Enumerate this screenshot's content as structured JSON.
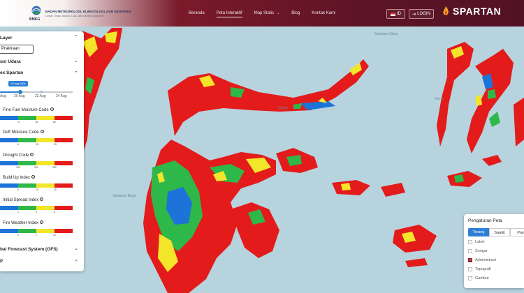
{
  "header": {
    "agency_name": "BADAN METEOROLOGI, KLIMATOLOGI, DAN GEOFISIKA",
    "agency_tagline": "Cepat, Tepat, Akurat, Luas, dan Mudah Dipahami",
    "logo_label": "BMKG",
    "nav": [
      {
        "label": "Beranda"
      },
      {
        "label": "Peta Interaktif"
      },
      {
        "label": "Map Statis"
      },
      {
        "label": "Blog"
      },
      {
        "label": "Kontak Kami"
      }
    ],
    "lang_button": "ID",
    "login_button": "LOGIN",
    "app_name": "SPARTAN"
  },
  "sidebar": {
    "layer_title": "Layer",
    "layer_select": "Prakiraan",
    "section_polusi": "usi Udara",
    "section_spartan": "ex Spartan",
    "date_bubble": "20 Aug 2024",
    "dates": [
      "Aug",
      "20 Aug",
      "22 Aug",
      "24 Aug"
    ],
    "indices": [
      {
        "name": "Fine Fuel Moisture Code",
        "ticks": [
          "73",
          "78",
          "82"
        ]
      },
      {
        "name": "Duff Moisture Code",
        "ticks": [
          "6",
          "15",
          "29"
        ]
      },
      {
        "name": "Drought Code",
        "ticks": [
          "141",
          "201",
          "300"
        ]
      },
      {
        "name": "Build Up Index",
        "ticks": [
          "6",
          "16",
          "30"
        ]
      },
      {
        "name": "Initial Spread Index",
        "ticks": [
          "1",
          "3",
          "6"
        ]
      },
      {
        "name": "Fire Weather Index",
        "ticks": [
          "0",
          "2",
          "12"
        ]
      }
    ],
    "section_gfs": "bal Forecast System (GFS)",
    "section_last": "p"
  },
  "map_labels": {
    "sulawesi_utara": "Sulawesi Utara",
    "gorontalo": "Goron",
    "ternate": "Terna",
    "sulawesi_barat": "Sulawesi Barat"
  },
  "settings": {
    "title": "Pengaturan Peta",
    "tabs": [
      "Terang",
      "Satelit",
      "Plai"
    ],
    "options": [
      {
        "label": "Label",
        "checked": false
      },
      {
        "label": "Sungai",
        "checked": false
      },
      {
        "label": "Administrasi",
        "checked": true
      },
      {
        "label": "Topografi",
        "checked": false
      },
      {
        "label": "Gambut",
        "checked": false
      }
    ]
  },
  "colors": {
    "header_maroon": "#5c1425",
    "accent_blue": "#2d7fd6",
    "risk_low": "#1e73d8",
    "risk_moderate": "#2fb84a",
    "risk_high": "#f2e52a",
    "risk_extreme": "#e31b1b"
  }
}
